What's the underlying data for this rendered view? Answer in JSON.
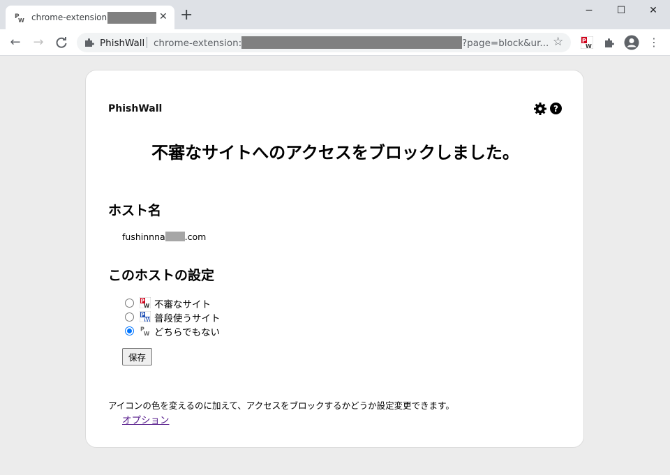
{
  "browser": {
    "tab": {
      "title": "chrome-extension://",
      "favicon": "phishwall-icon"
    },
    "new_tab": "+",
    "window_controls": {
      "minimize": "−",
      "maximize": "☐",
      "close": "✕"
    },
    "omnibox": {
      "extension_name": "PhishWall",
      "url_prefix": "chrome-extension://",
      "url_suffix": "?page=block&ur..."
    }
  },
  "page": {
    "brand": "PhishWall",
    "heading": "不審なサイトへのアクセスをブロックしました。",
    "host_section_title": "ホスト名",
    "host": {
      "prefix": "fushinnna",
      "suffix": ".com"
    },
    "settings_section_title": "このホストの設定",
    "options": [
      {
        "label": "不審なサイト",
        "icon": "phishwall-red-icon",
        "checked": false
      },
      {
        "label": "普段使うサイト",
        "icon": "phishwall-blue-icon",
        "checked": false
      },
      {
        "label": "どちらでもない",
        "icon": "phishwall-gray-icon",
        "checked": true
      }
    ],
    "save_button": "保存",
    "note": "アイコンの色を変えるのに加えて、アクセスをブロックするかどうか設定変更できます。",
    "option_link": "オプション"
  },
  "colors": {
    "suspicious": "#d0021b",
    "trusted": "#1f4fb5",
    "neutral": "#888888",
    "link": "#551a8b",
    "radio_accent": "#0075ff"
  }
}
